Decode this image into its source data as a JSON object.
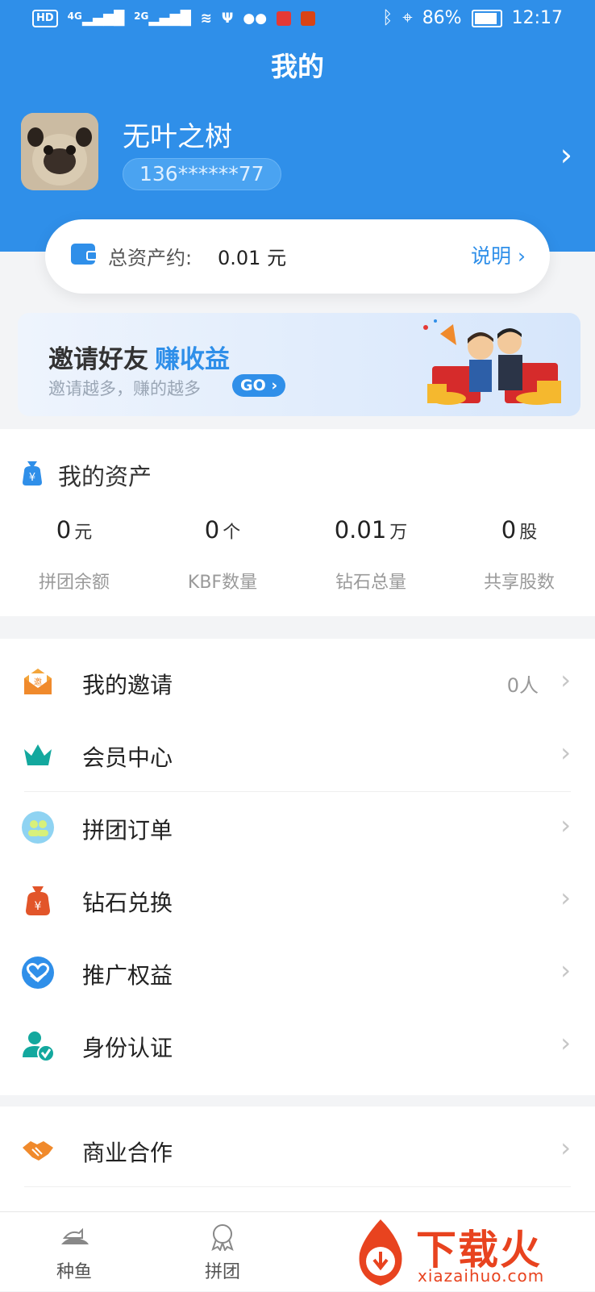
{
  "status_bar": {
    "left": "HD",
    "network": "4G",
    "network2": "2G",
    "battery": "86%",
    "time": "12:17"
  },
  "page_title": "我的",
  "profile": {
    "name": "无叶之树",
    "phone": "136******77"
  },
  "total_assets": {
    "label": "总资产约:",
    "value": "0.01 元",
    "explain": "说明"
  },
  "banner": {
    "title": "邀请好友",
    "highlight": "赚收益",
    "subtitle": "邀请越多，赚的越多",
    "go": "GO"
  },
  "my_assets": {
    "title": "我的资产",
    "stats": [
      {
        "value": "0",
        "unit": "元",
        "label": "拼团余额"
      },
      {
        "value": "0",
        "unit": "个",
        "label": "KBF数量"
      },
      {
        "value": "0.01",
        "unit": "万",
        "label": "钻石总量"
      },
      {
        "value": "0",
        "unit": "股",
        "label": "共享股数"
      }
    ]
  },
  "menu": [
    {
      "label": "我的邀请",
      "value": "0人",
      "icon": "invite-envelope-icon"
    },
    {
      "label": "会员中心",
      "value": "",
      "icon": "crown-icon"
    },
    {
      "label": "拼团订单",
      "value": "",
      "icon": "group-order-icon"
    },
    {
      "label": "钻石兑换",
      "value": "",
      "icon": "money-bag-icon"
    },
    {
      "label": "推广权益",
      "value": "",
      "icon": "heart-hand-icon"
    },
    {
      "label": "身份认证",
      "value": "",
      "icon": "verified-user-icon"
    }
  ],
  "menu2": [
    {
      "label": "商业合作",
      "icon": "handshake-icon"
    }
  ],
  "tabs": [
    {
      "label": "种鱼",
      "icon": "fish-icon"
    },
    {
      "label": "拼团",
      "icon": "medal-icon"
    }
  ],
  "watermark": {
    "cn": "下载火",
    "en": "xiazaihuo.com"
  },
  "colors": {
    "primary": "#2f8fe9",
    "accent_orange": "#f08a2c",
    "watermark": "#e8431f"
  }
}
